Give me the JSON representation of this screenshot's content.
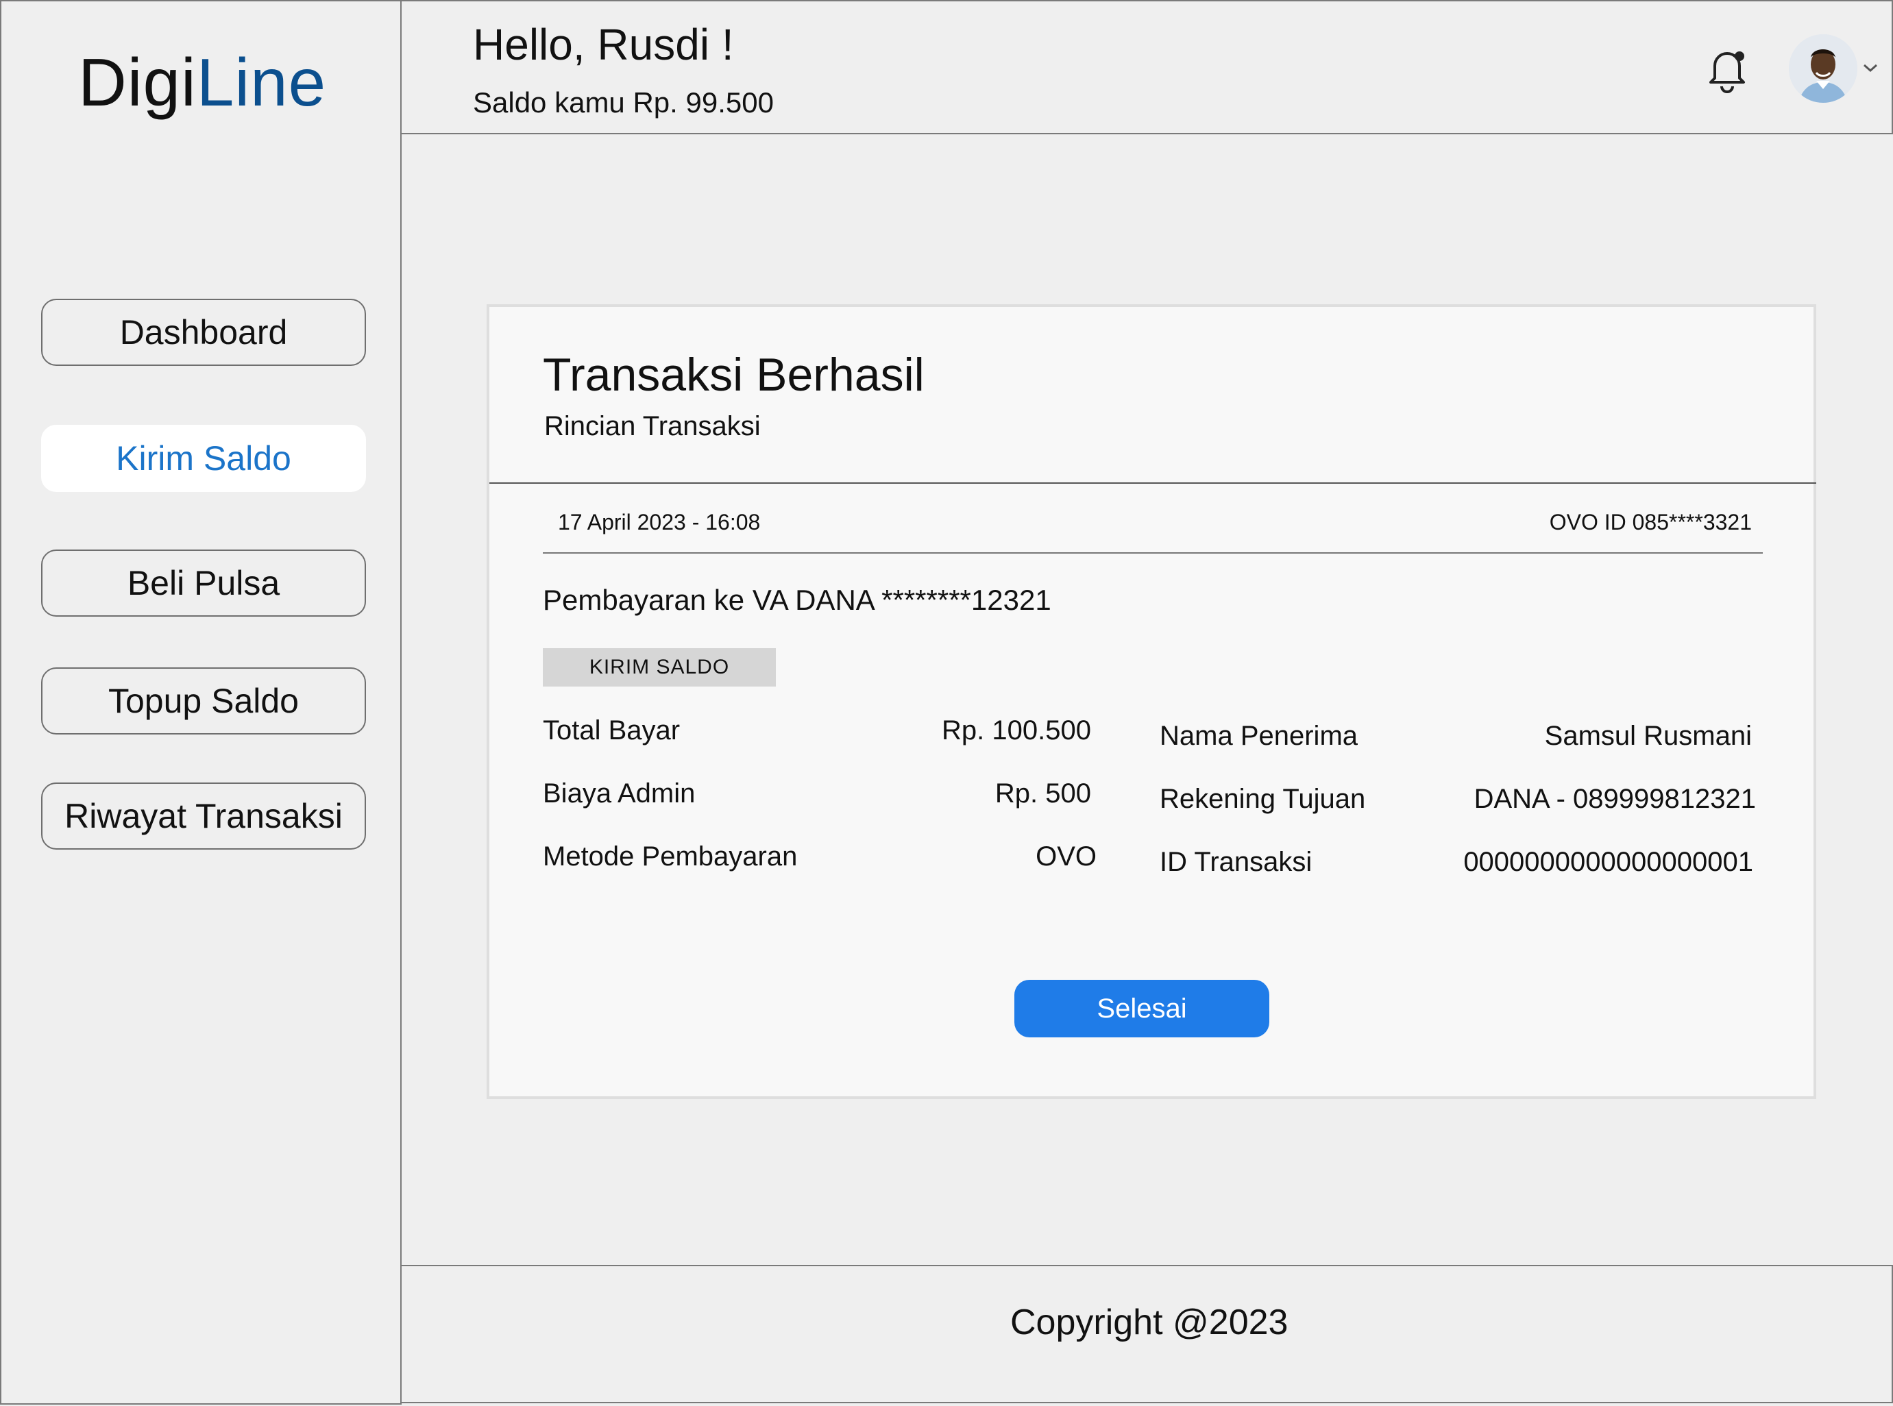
{
  "brand": {
    "part1": "Digi",
    "part2": "Line"
  },
  "sidebar": {
    "items": [
      {
        "label": "Dashboard"
      },
      {
        "label": "Kirim Saldo"
      },
      {
        "label": "Beli Pulsa"
      },
      {
        "label": "Topup Saldo"
      },
      {
        "label": "Riwayat Transaksi"
      }
    ]
  },
  "header": {
    "greeting": "Hello, Rusdi !",
    "saldo": "Saldo kamu Rp. 99.500"
  },
  "card": {
    "title": "Transaksi Berhasil",
    "subtitle": "Rincian Transaksi",
    "date": "17 April 2023 - 16:08",
    "ovo_id": "OVO ID 085****3321",
    "payment_to": "Pembayaran ke VA DANA ********12321",
    "tag": "KIRIM SALDO",
    "left_details": [
      {
        "label": "Total Bayar",
        "value": "Rp. 100.500"
      },
      {
        "label": "Biaya Admin",
        "value": "Rp. 500"
      },
      {
        "label": "Metode Pembayaran",
        "value": "OVO"
      }
    ],
    "right_details": [
      {
        "label": "Nama Penerima",
        "value": "Samsul Rusmani"
      },
      {
        "label": "Rekening Tujuan",
        "value": "DANA - 089999812321"
      },
      {
        "label": "ID Transaksi",
        "value": "0000000000000000001"
      }
    ],
    "done_button": "Selesai"
  },
  "footer": {
    "copyright": "Copyright @2023"
  },
  "colors": {
    "brand_blue": "#0b4f8e",
    "active_nav": "#1b74c9",
    "primary_button": "#1f7ce8"
  }
}
